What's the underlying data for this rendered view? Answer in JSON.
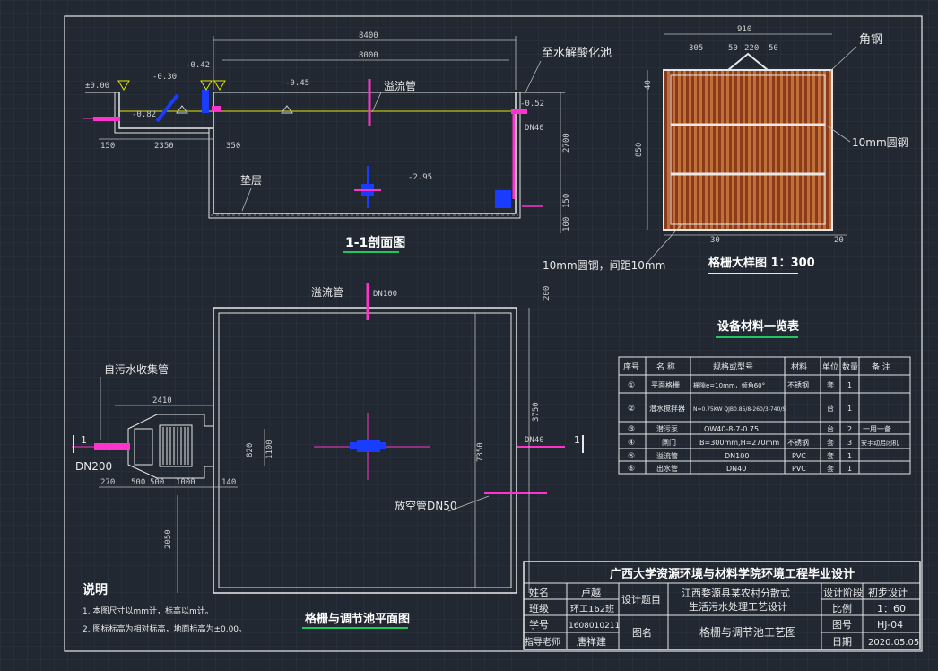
{
  "section": {
    "title": "1-1剖面图",
    "dim_total_outer": "8400",
    "dim_total_inner": "8000",
    "levels": [
      "±0.00",
      "-0.30",
      "-0.42",
      "-0.45",
      "-0.82",
      "-2.95"
    ],
    "dims_bottom": [
      "150",
      "2350",
      "350"
    ],
    "dim_right": "2700",
    "dim_right_small": [
      "150",
      "100"
    ],
    "outlet_label": "至水解酸化池",
    "overflow_label": "溢流管",
    "pipe_label": "DN40",
    "cushion_label": "垫层",
    "outlet_level": "-0.52"
  },
  "grid_detail": {
    "title": "格栅大样图 1：300",
    "width": "910",
    "top_dims": [
      "305",
      "50",
      "220",
      "50"
    ],
    "height": "850",
    "small_top": "40",
    "bottom_left": "30",
    "bottom_right": "20",
    "angle_label": "角钢",
    "rod_label": "10mm圆钢",
    "bar_label": "10mm圆钢，间距10mm"
  },
  "plan": {
    "title": "格栅与调节池平面图",
    "overflow_label": "溢流管",
    "overflow_dn": "DN100",
    "sewage_label": "自污水收集管",
    "inlet_dn": "DN200",
    "dn40": "DN40",
    "drain_label": "放空管DN50",
    "dim_2410": "2410",
    "dims_bottom": [
      "270",
      "500",
      "500",
      "1000",
      "140"
    ],
    "dim_820": "820",
    "dim_1100": "1100",
    "dim_3750": "3750",
    "dim_7350": "7350",
    "dim_2050": "2050",
    "dim_200": "200",
    "section_mark": "1"
  },
  "equipment": {
    "title": "设备材料一览表",
    "headers": [
      "序号",
      "名 称",
      "规格或型号",
      "材料",
      "单位",
      "数量",
      "备 注"
    ],
    "rows": [
      [
        "①",
        "平面格栅",
        "栅隙e=10mm，倾角60°",
        "不锈钢",
        "套",
        "1",
        ""
      ],
      [
        "②",
        "潜水搅拌器",
        "N=0.75KW|QJB0.85/8-260/3-740/S",
        "",
        "台",
        "1",
        ""
      ],
      [
        "③",
        "潜污泵",
        "QW40-8-7-0.75",
        "",
        "台",
        "2",
        "一用一备"
      ],
      [
        "④",
        "闸门",
        "B=300mm,H=270mm",
        "不锈钢",
        "套",
        "3",
        "安手动启闭机"
      ],
      [
        "⑤",
        "溢流管",
        "DN100",
        "PVC",
        "套",
        "1",
        ""
      ],
      [
        "⑥",
        "出水管",
        "DN40",
        "PVC",
        "套",
        "1",
        ""
      ]
    ]
  },
  "notes": {
    "title": "说明",
    "items": [
      "1. 本图尺寸以mm计，标高以m计。",
      "2. 图标标高为相对标高，地面标高为±0.00。"
    ]
  },
  "title_block": {
    "school": "广西大学资源环境与材料学院环境工程毕业设计",
    "name_label": "姓名",
    "name": "卢越",
    "class_label": "班级",
    "class": "环工162班",
    "id_label": "学号",
    "id": "1608010211",
    "advisor_label": "指导老师",
    "advisor": "唐祥建",
    "topic_label": "设计题目",
    "topic_line1": "江西婺源县某农村分散式",
    "topic_line2": "生活污水处理工艺设计",
    "stage_label": "设计阶段",
    "stage": "初步设计",
    "scale_label": "比例",
    "scale": "1：60",
    "drawing_label": "图名",
    "drawing": "格栅与调节池工艺图",
    "no_label": "图号",
    "no": "HJ-04",
    "date_label": "日期",
    "date": "2020.05.05"
  },
  "colors": {
    "background": "#212832",
    "line": "#e8e8e8",
    "water": "#e6e600",
    "pipe": "#ff33cc",
    "equipment": "#1a3cff",
    "grate": "#a0522d",
    "green": "#22c55e"
  }
}
